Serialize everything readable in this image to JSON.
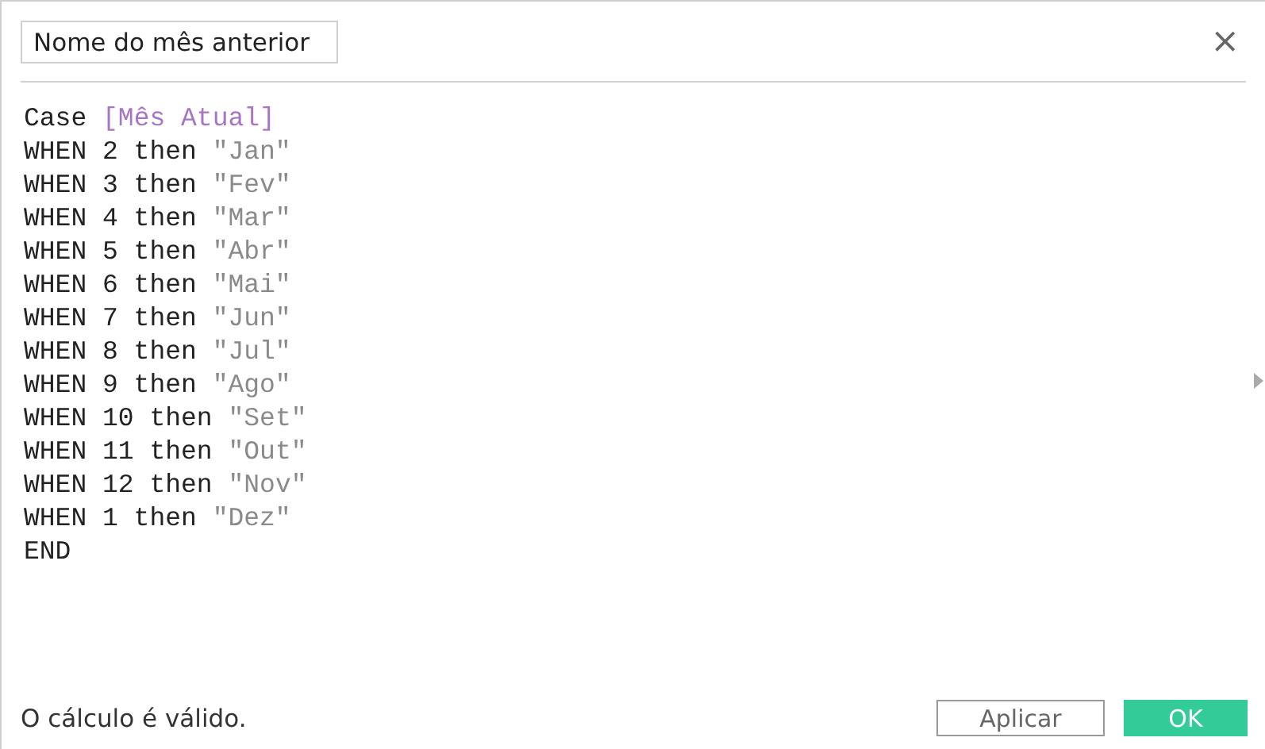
{
  "dialog": {
    "name_field": {
      "value": "Nome do mês anterior"
    },
    "close": "×"
  },
  "code": [
    [
      {
        "kind": "keyword",
        "text": "Case "
      },
      {
        "kind": "field",
        "text": "[Mês Atual]"
      }
    ],
    [
      {
        "kind": "keyword",
        "text": "WHEN 2 then "
      },
      {
        "kind": "string",
        "text": "\"Jan\""
      }
    ],
    [
      {
        "kind": "keyword",
        "text": "WHEN 3 then "
      },
      {
        "kind": "string",
        "text": "\"Fev\""
      }
    ],
    [
      {
        "kind": "keyword",
        "text": "WHEN 4 then "
      },
      {
        "kind": "string",
        "text": "\"Mar\""
      }
    ],
    [
      {
        "kind": "keyword",
        "text": "WHEN 5 then "
      },
      {
        "kind": "string",
        "text": "\"Abr\""
      }
    ],
    [
      {
        "kind": "keyword",
        "text": "WHEN 6 then "
      },
      {
        "kind": "string",
        "text": "\"Mai\""
      }
    ],
    [
      {
        "kind": "keyword",
        "text": "WHEN 7 then "
      },
      {
        "kind": "string",
        "text": "\"Jun\""
      }
    ],
    [
      {
        "kind": "keyword",
        "text": "WHEN 8 then "
      },
      {
        "kind": "string",
        "text": "\"Jul\""
      }
    ],
    [
      {
        "kind": "keyword",
        "text": "WHEN 9 then "
      },
      {
        "kind": "string",
        "text": "\"Ago\""
      }
    ],
    [
      {
        "kind": "keyword",
        "text": "WHEN 10 then "
      },
      {
        "kind": "string",
        "text": "\"Set\""
      }
    ],
    [
      {
        "kind": "keyword",
        "text": "WHEN 11 then "
      },
      {
        "kind": "string",
        "text": "\"Out\""
      }
    ],
    [
      {
        "kind": "keyword",
        "text": "WHEN 12 then "
      },
      {
        "kind": "string",
        "text": "\"Nov\""
      }
    ],
    [
      {
        "kind": "keyword",
        "text": "WHEN 1 then "
      },
      {
        "kind": "string",
        "text": "\"Dez\""
      }
    ],
    [
      {
        "kind": "keyword",
        "text": "END"
      }
    ]
  ],
  "status": "O cálculo é válido.",
  "buttons": [
    {
      "label": "Aplicar",
      "kind": "secondary"
    },
    {
      "label": "OK",
      "kind": "primary"
    }
  ]
}
